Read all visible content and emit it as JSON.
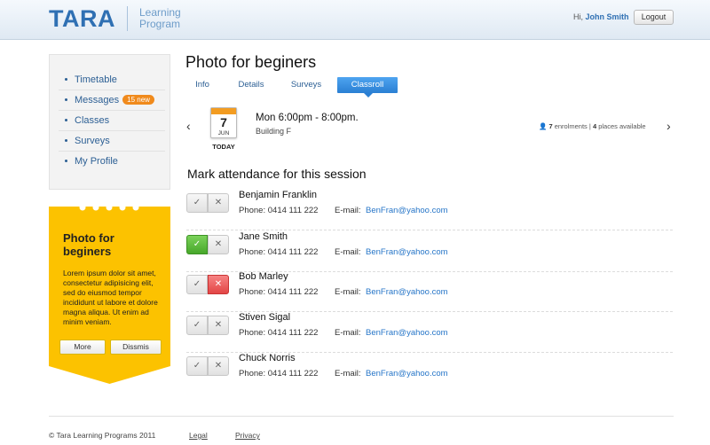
{
  "header": {
    "logo": "TARA",
    "logo_sub_line1": "Learning",
    "logo_sub_line2": "Program",
    "greeting": "Hi,",
    "user_name": "John Smith",
    "logout_label": "Logout"
  },
  "sidebar": {
    "items": [
      {
        "label": "Timetable"
      },
      {
        "label": "Messages",
        "badge": "15 new"
      },
      {
        "label": "Classes"
      },
      {
        "label": "Surveys"
      },
      {
        "label": "My Profile"
      }
    ]
  },
  "promo": {
    "title": "Photo for beginers",
    "text": "Lorem ipsum dolor sit amet, consectetur adipisicing elit, sed do eiusmod tempor incididunt ut labore et dolore magna aliqua. Ut enim ad minim veniam.",
    "more_label": "More",
    "dismiss_label": "Dissmis",
    "color": "#fcc200"
  },
  "main": {
    "title": "Photo for beginers",
    "tabs": [
      {
        "label": "Info"
      },
      {
        "label": "Details"
      },
      {
        "label": "Surveys"
      },
      {
        "label": "Classroll",
        "active": true
      }
    ],
    "session": {
      "day": "7",
      "month": "JUN",
      "today_label": "TODAY",
      "time": "Mon 6:00pm - 8:00pm.",
      "place": "Building F",
      "enrolments": "7",
      "enrolments_label": "enrolments |",
      "places": "4",
      "places_label": "places available"
    },
    "attendance_title": "Mark attendance for this session",
    "phone_label": "Phone:",
    "email_label": "E-mail:",
    "people": [
      {
        "name": "Benjamin Franklin",
        "phone": "0414 111 222",
        "email": "BenFran@yahoo.com",
        "status": "none"
      },
      {
        "name": "Jane Smith",
        "phone": "0414 111 222",
        "email": "BenFran@yahoo.com",
        "status": "present"
      },
      {
        "name": "Bob Marley",
        "phone": "0414 111 222",
        "email": "BenFran@yahoo.com",
        "status": "absent"
      },
      {
        "name": "Stiven Sigal",
        "phone": "0414 111 222",
        "email": "BenFran@yahoo.com",
        "status": "none"
      },
      {
        "name": "Chuck Norris",
        "phone": "0414 111 222",
        "email": "BenFran@yahoo.com",
        "status": "none"
      }
    ]
  },
  "footer": {
    "copyright": "© Tara Learning Programs 2011",
    "legal": "Legal",
    "privacy": "Privacy"
  },
  "colors": {
    "brand": "#2f70b3",
    "present": "#47a72a",
    "absent": "#e24545",
    "tab_active": "#2a7fd3"
  }
}
